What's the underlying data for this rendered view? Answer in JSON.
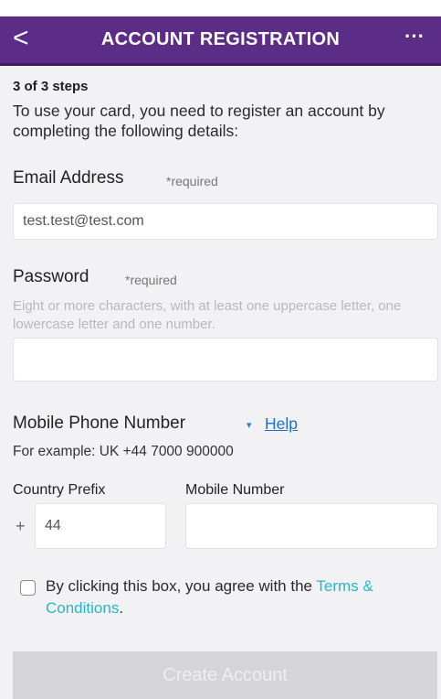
{
  "header": {
    "title": "ACCOUNT REGISTRATION",
    "back_glyph": "<",
    "more_glyph": "···"
  },
  "form": {
    "steps": "3 of 3 steps",
    "intro": "To use your card, you need to register an account by completing the following details:",
    "email": {
      "label": "Email Address",
      "required": "*required",
      "value": "test.test@test.com"
    },
    "password": {
      "label": "Password",
      "required": "*required",
      "hint": "Eight or more characters, with at least one uppercase letter, one lowercase letter and one number.",
      "value": ""
    },
    "mobile": {
      "label": "Mobile Phone Number",
      "help_caret": "▾",
      "help": "Help",
      "example": "For example: UK +44 7000 900000",
      "country_prefix_label": "Country Prefix",
      "mobile_number_label": "Mobile Number",
      "plus": "+",
      "country_prefix_value": "44",
      "mobile_number_value": ""
    },
    "terms": {
      "text": "By clicking this box, you agree with the ",
      "link": "Terms & Conditions",
      "suffix": "."
    },
    "submit_label": "Create Account"
  },
  "colors": {
    "header_purple": "#5c2d86",
    "link_blue": "#1f6fc8",
    "terms_teal": "#2bb5c8",
    "disabled_button": "#d5d5d8"
  }
}
